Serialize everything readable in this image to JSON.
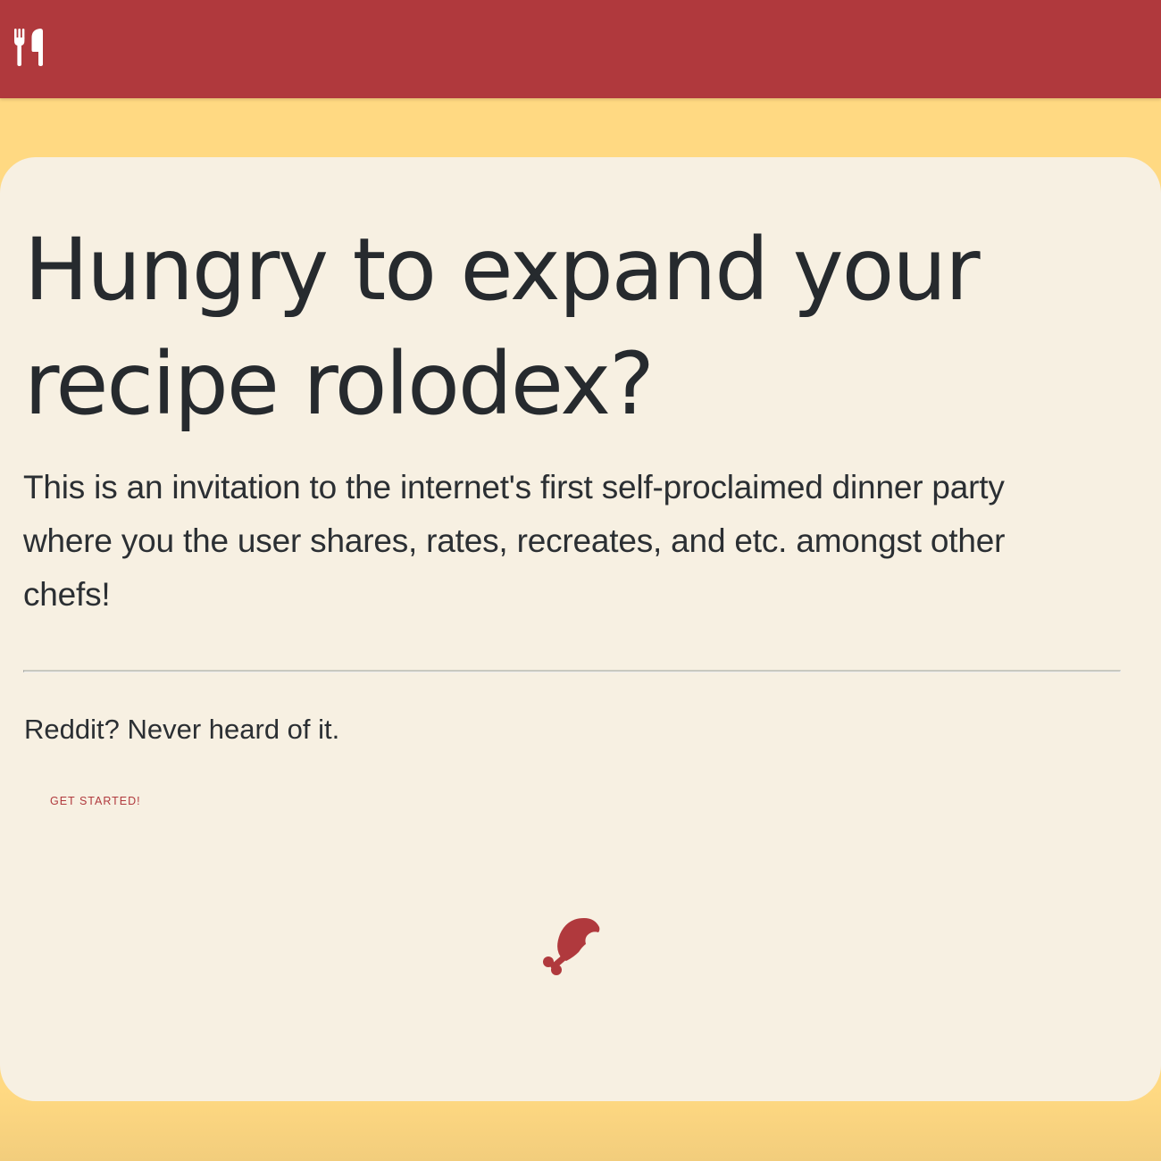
{
  "navbar": {
    "logo_icon": "fork-knife-icon",
    "background_color": "#b0393d"
  },
  "hero": {
    "headline": "Hungry to expand your recipe rolodex?",
    "lead": "This is an invitation to the internet's first self-proclaimed dinner party where you the user shares, rates, recreates, and etc. amongst other chefs!",
    "tagline": "Reddit? Never heard of it.",
    "cta_label": "GET STARTED!",
    "decoration_icon": "drumstick-icon"
  },
  "colors": {
    "accent": "#b0393d",
    "page_background": "#ffd982",
    "card_background": "#f7f0e2",
    "text": "#262a2e"
  }
}
